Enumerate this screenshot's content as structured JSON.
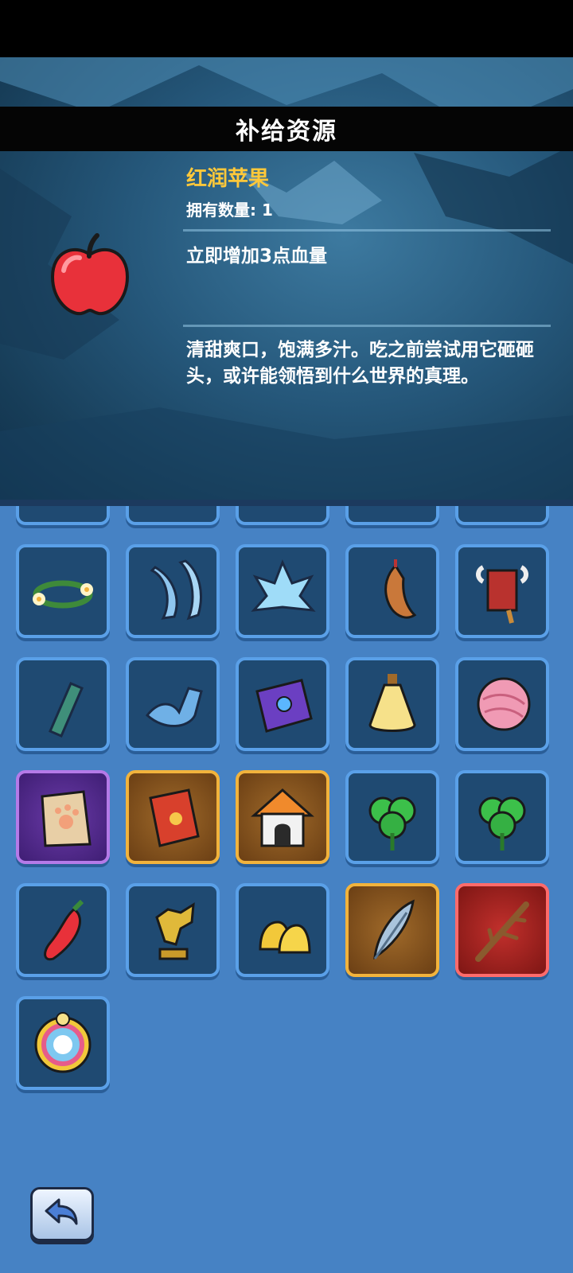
{
  "header": {
    "title": "补给资源"
  },
  "detail": {
    "name": "红润苹果",
    "count_label": "拥有数量: 1",
    "effect": "立即增加3点血量",
    "description": "清甜爽口，饱满多汁。吃之前尝试用它砸砸头，或许能领悟到什么世界的真理。",
    "icon": "red-apple-icon"
  },
  "inventory": {
    "rows": [
      [
        {
          "icon": "flower-wreath-icon",
          "rarity": "common"
        },
        {
          "icon": "ice-claws-icon",
          "rarity": "common"
        },
        {
          "icon": "ice-crystal-icon",
          "rarity": "common"
        },
        {
          "icon": "meat-sausage-icon",
          "rarity": "common"
        },
        {
          "icon": "horned-banner-icon",
          "rarity": "common"
        }
      ],
      [
        {
          "icon": "green-chalk-icon",
          "rarity": "common"
        },
        {
          "icon": "blue-fin-icon",
          "rarity": "common"
        },
        {
          "icon": "purple-eye-book-icon",
          "rarity": "common"
        },
        {
          "icon": "yellow-potion-icon",
          "rarity": "common"
        },
        {
          "icon": "pink-yarn-ball-icon",
          "rarity": "common"
        }
      ],
      [
        {
          "icon": "paw-paper-bag-icon",
          "rarity": "purple"
        },
        {
          "icon": "paw-book-icon",
          "rarity": "orange"
        },
        {
          "icon": "pet-house-icon",
          "rarity": "orange"
        },
        {
          "icon": "clover-icon",
          "rarity": "common"
        },
        {
          "icon": "clover-icon",
          "rarity": "common"
        }
      ],
      [
        {
          "icon": "red-pepper-icon",
          "rarity": "common"
        },
        {
          "icon": "dragon-statue-icon",
          "rarity": "common"
        },
        {
          "icon": "golden-bells-icon",
          "rarity": "common"
        },
        {
          "icon": "feather-icon",
          "rarity": "orange"
        },
        {
          "icon": "branch-icon",
          "rarity": "red"
        }
      ],
      [
        {
          "icon": "rainbow-compass-icon",
          "rarity": "common"
        }
      ]
    ]
  },
  "footer": {
    "back_icon": "back-arrow-icon"
  },
  "colors": {
    "panel_blue": "#4682c4",
    "title_yellow": "#ffc83a",
    "slot_fill": "#1f4a72"
  }
}
